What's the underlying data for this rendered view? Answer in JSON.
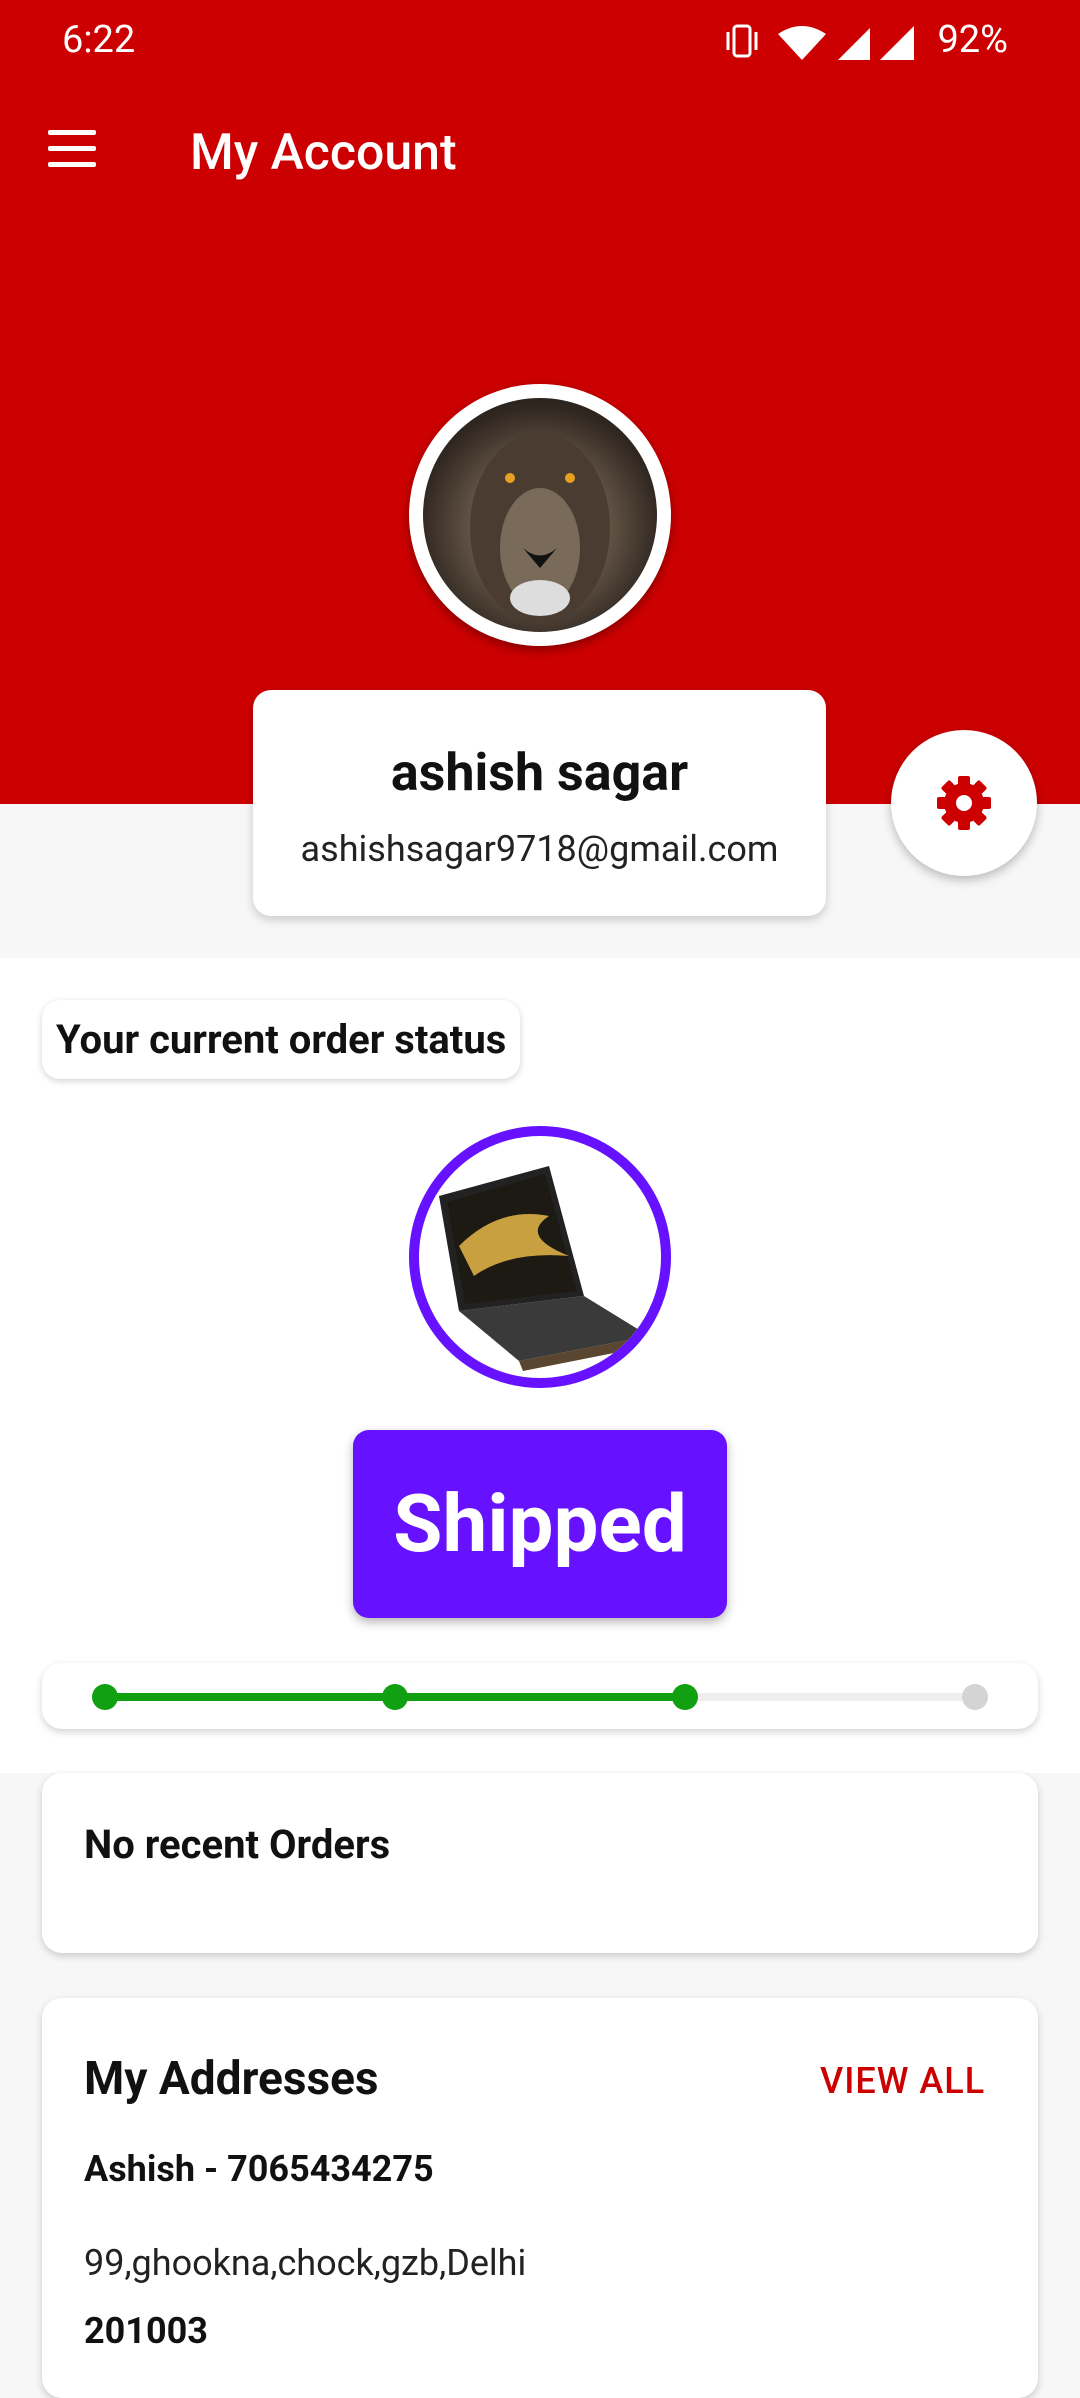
{
  "status_bar": {
    "time": "6:22",
    "battery": "92%"
  },
  "app_bar": {
    "title": "My Account"
  },
  "profile": {
    "name": "ashish sagar",
    "email": "ashishsagar9718@gmail.com"
  },
  "order_status": {
    "label": "Your current order status",
    "status": "Shipped",
    "progress": {
      "completed_steps": 3,
      "total_steps": 4
    },
    "accent_color": "#6611ff",
    "progress_color": "#11a011"
  },
  "recent_orders": {
    "text": "No recent Orders"
  },
  "addresses": {
    "title": "My Addresses",
    "view_all": "VIEW ALL",
    "name": "Ashish - 7065434275",
    "line": "99,ghookna,chock,gzb,Delhi",
    "pincode": "201003"
  },
  "theme": {
    "primary": "#cc0000"
  },
  "icons": {
    "menu": "hamburger-menu-icon",
    "settings": "gear-icon"
  }
}
